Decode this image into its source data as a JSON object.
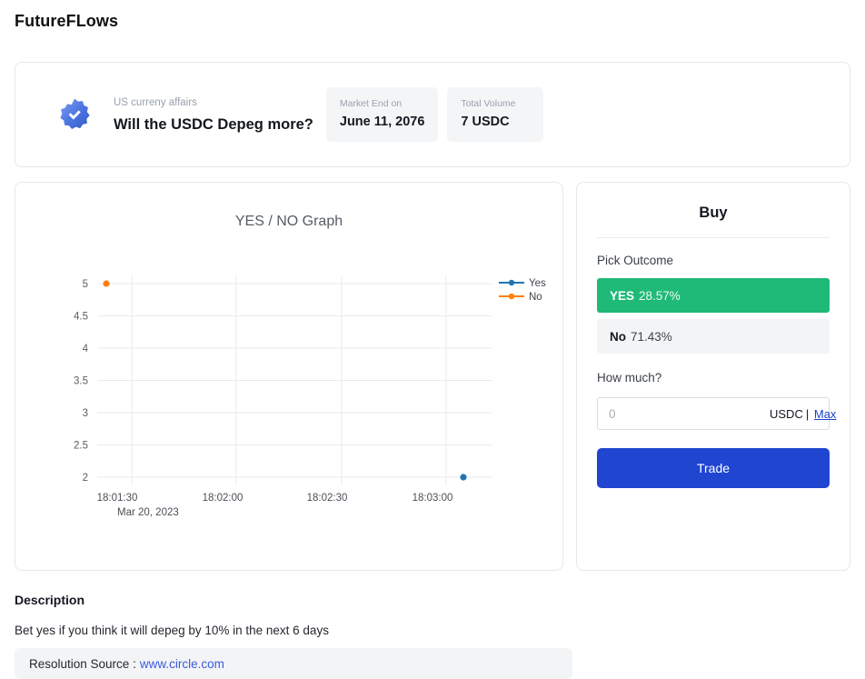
{
  "brand": "FutureFLows",
  "market": {
    "category": "US curreny affairs",
    "question": "Will the USDC Depeg more?",
    "verified_icon": "verified-badge-icon",
    "stats": [
      {
        "label": "Market End on",
        "value": "June 11, 2076"
      },
      {
        "label": "Total Volume",
        "value": "7 USDC"
      }
    ]
  },
  "chart_data": {
    "type": "scatter",
    "title": "YES / NO Graph",
    "xlabel": "",
    "ylabel": "",
    "x_tick_labels": [
      "18:01:30",
      "18:02:00",
      "18:02:30",
      "18:03:00"
    ],
    "x_axis_date": "Mar 20, 2023",
    "y_tick_labels": [
      "5",
      "4.5",
      "4",
      "3.5",
      "3",
      "2.5",
      "2"
    ],
    "ylim": [
      2,
      5
    ],
    "grid": true,
    "legend_position": "right",
    "series": [
      {
        "name": "Yes",
        "color": "#1f77b4",
        "x": [
          "18:03:10"
        ],
        "values": [
          2
        ]
      },
      {
        "name": "No",
        "color": "#ff7f0e",
        "x": [
          "18:01:22"
        ],
        "values": [
          5
        ]
      }
    ]
  },
  "buy": {
    "title": "Buy",
    "pick_outcome_label": "Pick Outcome",
    "outcomes": [
      {
        "key": "YES",
        "value": "28.57%",
        "selected": true,
        "color": "#1fb978"
      },
      {
        "key": "No",
        "value": "71.43%",
        "selected": false,
        "color": "#f3f4f6"
      }
    ],
    "how_much_label": "How much?",
    "amount_value": "",
    "amount_placeholder": "0",
    "currency_suffix": "USDC",
    "suffix_separator": "|",
    "max_label": "Max",
    "trade_label": "Trade",
    "trade_color": "#1f45d1"
  },
  "description": {
    "heading": "Description",
    "body": "Bet yes if you think it will depeg by 10% in the next 6 days",
    "resolution_label": "Resolution Source :",
    "resolution_link": "www.circle.com"
  }
}
